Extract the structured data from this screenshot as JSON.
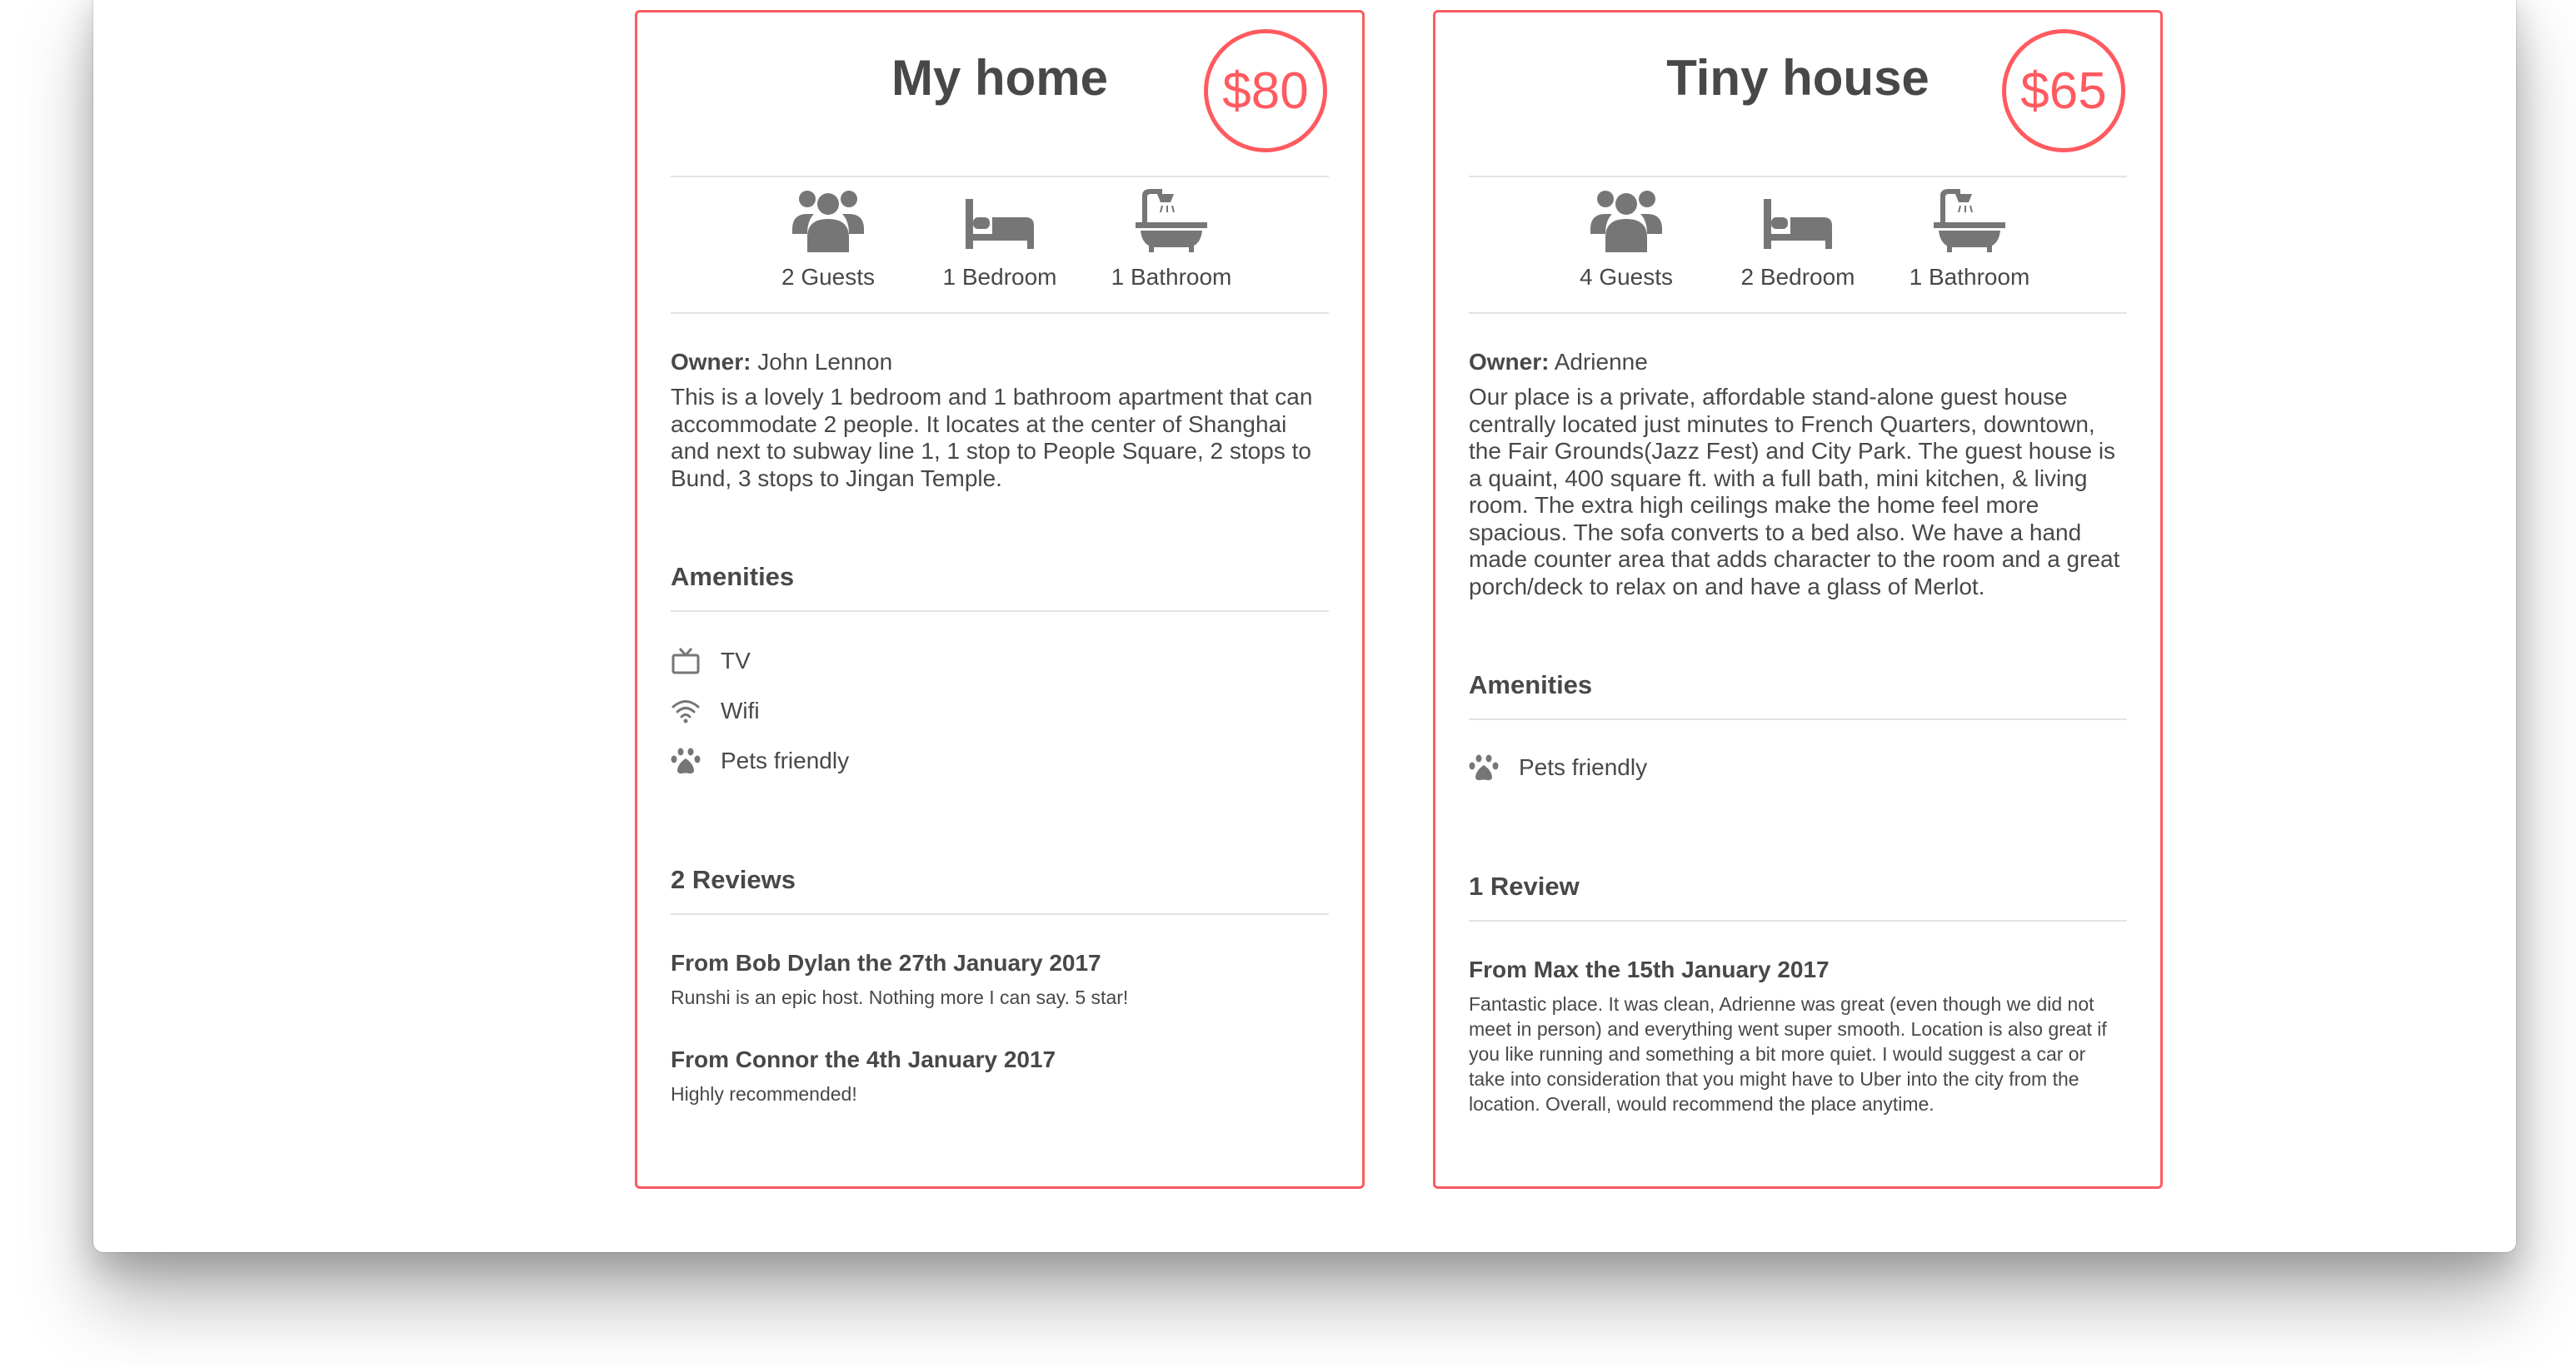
{
  "listings": [
    {
      "title": "My home",
      "price": "$80",
      "stats": {
        "guests": "2 Guests",
        "bedrooms": "1 Bedroom",
        "bathrooms": "1 Bathroom"
      },
      "owner_label": "Owner:",
      "owner_name": " John Lennon",
      "description": "This is a lovely 1 bedroom and 1 bathroom apartment that can accommodate 2 people. It locates at the center of Shanghai and next to subway line 1, 1 stop to People Square, 2 stops to Bund, 3 stops to Jingan Temple.",
      "amenities_heading": "Amenities",
      "amenities": [
        {
          "icon": "tv-icon",
          "label": "TV"
        },
        {
          "icon": "wifi-icon",
          "label": "Wifi"
        },
        {
          "icon": "paw-icon",
          "label": "Pets friendly"
        }
      ],
      "reviews_heading": "2 Reviews",
      "reviews": [
        {
          "heading": "From Bob Dylan the 27th January 2017",
          "text": "Runshi is an epic host. Nothing more I can say. 5 star!"
        },
        {
          "heading": "From Connor the 4th January 2017",
          "text": "Highly recommended!"
        }
      ]
    },
    {
      "title": "Tiny house",
      "price": "$65",
      "stats": {
        "guests": "4 Guests",
        "bedrooms": "2 Bedroom",
        "bathrooms": "1 Bathroom"
      },
      "owner_label": "Owner:",
      "owner_name": " Adrienne",
      "description": "Our place is a private, affordable stand-alone guest house centrally located just minutes to French Quarters, downtown, the Fair Grounds(Jazz Fest) and City Park. The guest house is a quaint, 400 square ft. with a full bath, mini kitchen, & living room. The extra high ceilings make the home feel more spacious. The sofa converts to a bed also. We have a hand made counter area that adds character to the room and a great porch/deck to relax on and have a glass of Merlot.",
      "amenities_heading": "Amenities",
      "amenities": [
        {
          "icon": "paw-icon",
          "label": "Pets friendly"
        }
      ],
      "reviews_heading": "1 Review",
      "reviews": [
        {
          "heading": "From Max the 15th January 2017",
          "text": "Fantastic place. It was clean, Adrienne was great (even though we did not meet in person) and everything went super smooth. Location is also great if you like running and something a bit more quiet. I would suggest a car or take into consideration that you might have to Uber into the city from the location. Overall, would recommend the place anytime."
        }
      ]
    }
  ],
  "colors": {
    "accent": "#ff5a5f",
    "text": "#484848",
    "icon": "#767676"
  }
}
